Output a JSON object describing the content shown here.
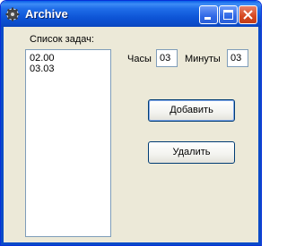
{
  "window": {
    "title": "Archive"
  },
  "tasks": {
    "label": "Список задач:",
    "items": [
      "02.00",
      "03.03"
    ]
  },
  "time": {
    "hours_label": "Часы",
    "hours_value": "03",
    "minutes_label": "Минуты",
    "minutes_value": "03"
  },
  "buttons": {
    "add_label": "Добавить",
    "remove_label": "Удалить"
  },
  "icons": {
    "app": "gear-icon",
    "minimize": "minimize-icon",
    "maximize": "maximize-icon",
    "close": "close-icon"
  },
  "colors": {
    "titlebar": "#0b4bc8",
    "dialog_background": "#ece9d8",
    "close_button": "#d5471f"
  }
}
